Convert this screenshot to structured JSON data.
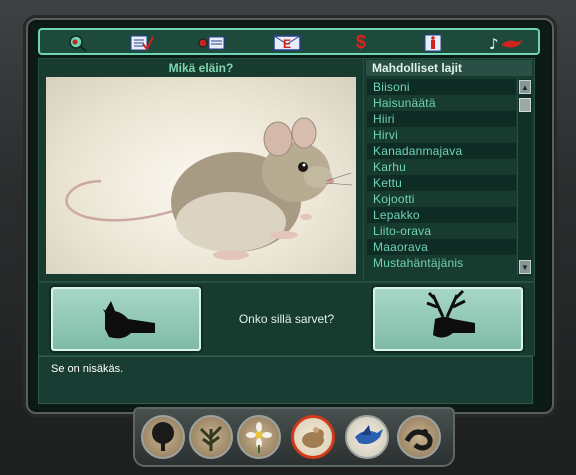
{
  "question_panel": {
    "title": "Mikä eläin?"
  },
  "species_list": {
    "title": "Mahdolliset lajit",
    "items": [
      "Biisoni",
      "Haisunäätä",
      "Hiiri",
      "Hirvi",
      "Kanadanmajava",
      "Karhu",
      "Kettu",
      "Kojootti",
      "Lepakko",
      "Liito-orava",
      "Maaorava",
      "Mustahäntäjänis"
    ]
  },
  "identify": {
    "question": "Onko sillä sarvet?",
    "no_choice_icon": "hornless-deer-head-silhouette-icon",
    "yes_choice_icon": "antlered-deer-head-silhouette-icon"
  },
  "output_text": "Se on nisäkäs.",
  "toolbar_icons": [
    "search-magnifier-icon",
    "checklist-icon",
    "bug-card-icon",
    "email-icon",
    "dollar-icon",
    "info-icon",
    "music-bird-icon"
  ],
  "toolbar_glyphs": {
    "search": "🔍",
    "checklist": "☑",
    "bug": "▤",
    "email": "E",
    "dollar": "$",
    "info": "i",
    "music": "♪"
  },
  "category_icons": [
    "tree-icon",
    "plant-icon",
    "flower-icon",
    "mammal-icon",
    "bird-icon",
    "reptile-icon"
  ],
  "colors": {
    "accent": "#6fd3b5",
    "panel": "#183b30",
    "dollar": "#e0221f",
    "active_ring": "#d23a1c"
  }
}
